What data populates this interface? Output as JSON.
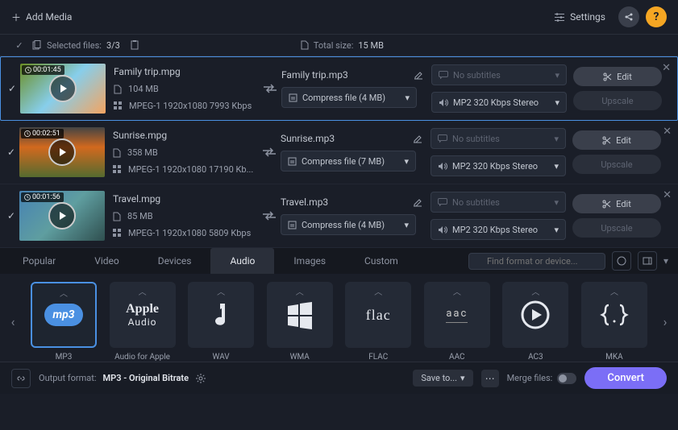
{
  "topbar": {
    "add_media": "Add Media",
    "settings": "Settings"
  },
  "infobar": {
    "selected_label": "Selected files:",
    "selected_value": "3/3",
    "total_label": "Total size:",
    "total_value": "15 MB"
  },
  "files": [
    {
      "selected": true,
      "duration": "00:01:45",
      "src_name": "Family trip.mpg",
      "size": "104 MB",
      "specs": "MPEG-1 1920x1080 7993 Kbps",
      "out_name": "Family trip.mp3",
      "compress": "Compress file (4 MB)",
      "subtitle": "No subtitles",
      "audio": "MP2 320 Kbps Stereo",
      "thumb_class": "family"
    },
    {
      "selected": false,
      "duration": "00:02:51",
      "src_name": "Sunrise.mpg",
      "size": "358 MB",
      "specs": "MPEG-1 1920x1080 17190 Kb...",
      "out_name": "Sunrise.mp3",
      "compress": "Compress file (7 MB)",
      "subtitle": "No subtitles",
      "audio": "MP2 320 Kbps Stereo",
      "thumb_class": "sunrise"
    },
    {
      "selected": false,
      "duration": "00:01:56",
      "src_name": "Travel.mpg",
      "size": "85 MB",
      "specs": "MPEG-1 1920x1080 5809 Kbps",
      "out_name": "Travel.mp3",
      "compress": "Compress file (4 MB)",
      "subtitle": "No subtitles",
      "audio": "MP2 320 Kbps Stereo",
      "thumb_class": "travel"
    }
  ],
  "row_actions": {
    "edit": "Edit",
    "upscale": "Upscale"
  },
  "tabs": [
    "Popular",
    "Video",
    "Devices",
    "Audio",
    "Images",
    "Custom"
  ],
  "active_tab": "Audio",
  "search_placeholder": "Find format or device...",
  "formats": [
    {
      "label": "MP3",
      "kind": "mp3",
      "selected": true
    },
    {
      "label": "Audio for Apple",
      "kind": "apple"
    },
    {
      "label": "WAV",
      "kind": "wav"
    },
    {
      "label": "WMA",
      "kind": "wma"
    },
    {
      "label": "FLAC",
      "kind": "flac"
    },
    {
      "label": "AAC",
      "kind": "aac"
    },
    {
      "label": "AC3",
      "kind": "ac3"
    },
    {
      "label": "MKA",
      "kind": "mka"
    }
  ],
  "bottom": {
    "output_label": "Output format:",
    "output_value": "MP3 - Original Bitrate",
    "save_to": "Save to...",
    "merge": "Merge files:",
    "convert": "Convert"
  }
}
